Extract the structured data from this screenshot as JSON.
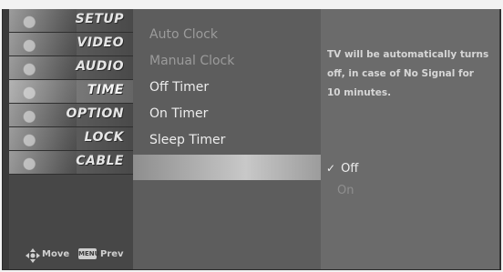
{
  "categories": [
    {
      "label": "SETUP"
    },
    {
      "label": "VIDEO"
    },
    {
      "label": "AUDIO"
    },
    {
      "label": "TIME"
    },
    {
      "label": "OPTION"
    },
    {
      "label": "LOCK"
    },
    {
      "label": "CABLE"
    }
  ],
  "hints": {
    "move_label": "Move",
    "prev_key": "MENU",
    "prev_label": "Prev"
  },
  "submenu": [
    {
      "label": "Auto Clock"
    },
    {
      "label": "Manual Clock"
    },
    {
      "label": "Off Timer"
    },
    {
      "label": "On Timer"
    },
    {
      "label": "Sleep Timer"
    },
    {
      "label": ""
    }
  ],
  "info": {
    "line1": "TV will be automatically turns",
    "line2": "off, in case of No Signal for",
    "line3": "10 minutes."
  },
  "options": {
    "off_label": "Off",
    "on_label": "On",
    "check": "✓"
  },
  "colors": {
    "highlight": "#c8c8c8",
    "left_menu_bg": "#474747",
    "submenu_bg": "#5d5d5d",
    "info_bg": "#6b6b6b"
  }
}
